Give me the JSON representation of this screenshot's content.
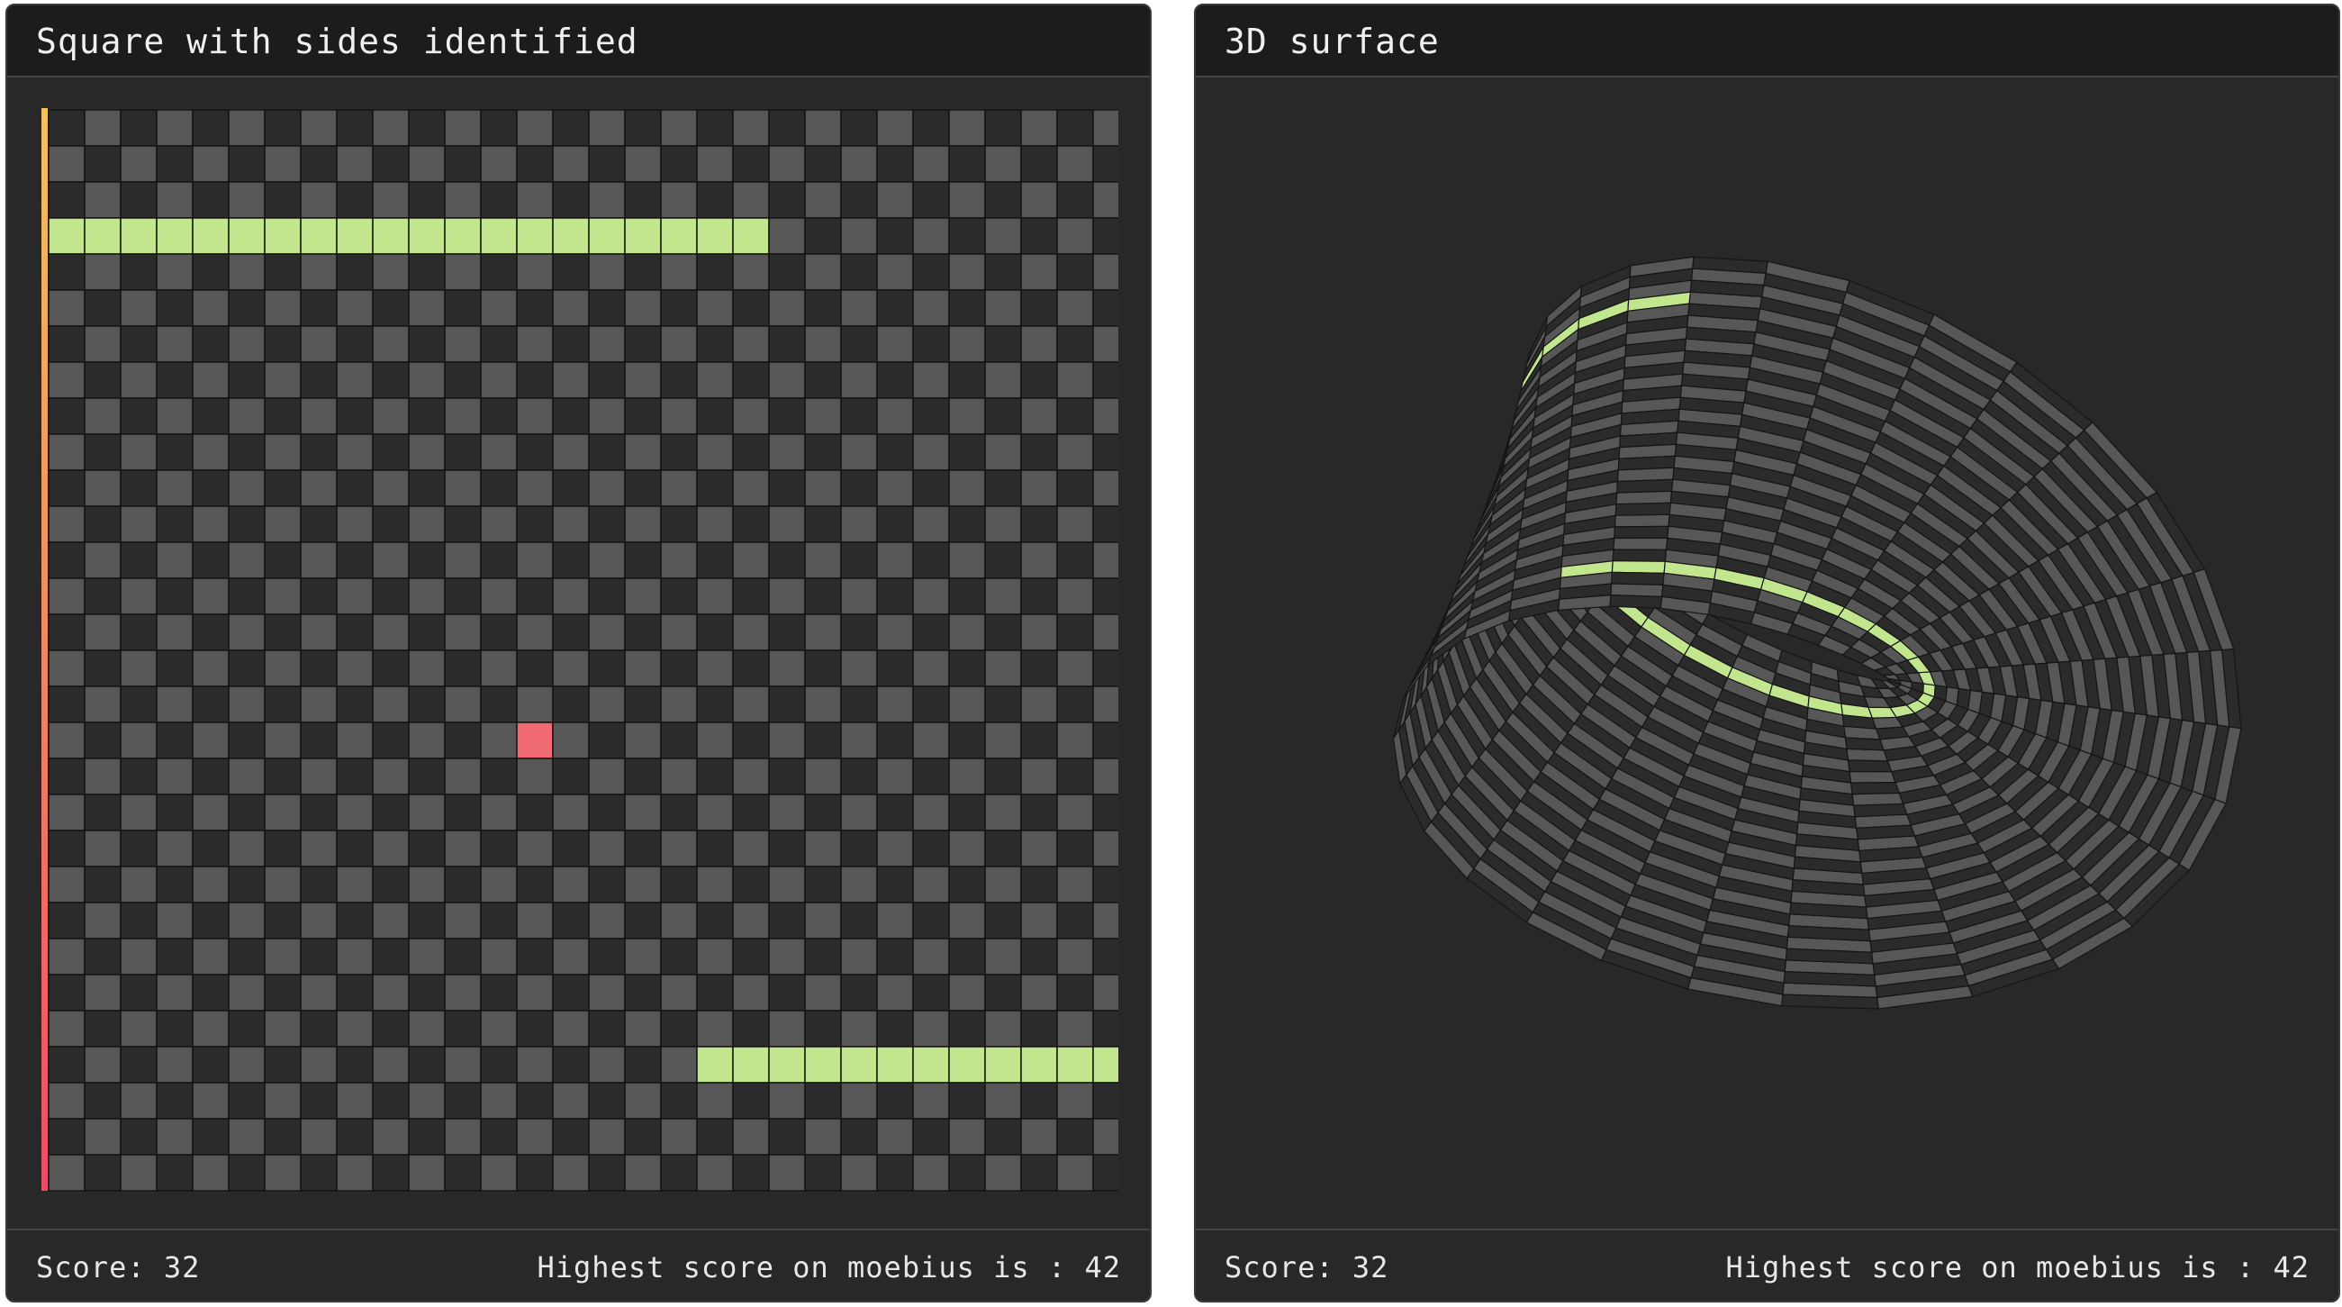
{
  "left_panel": {
    "title": "Square with sides identified",
    "footer": {
      "score_text": "Score: 32",
      "highscore_text": "Highest score on moebius is : 42"
    }
  },
  "right_panel": {
    "title": "3D surface",
    "footer": {
      "score_text": "Score: 32",
      "highscore_text": "Highest score on moebius is : 42"
    }
  },
  "game": {
    "score": 32,
    "highest_score": 42,
    "surface": "moebius",
    "grid_cols": 30,
    "grid_rows": 30,
    "snake_segments": [
      {
        "row": 3,
        "col_start": 0,
        "col_end": 19
      },
      {
        "row": 26,
        "col_start": 18,
        "col_end": 29
      }
    ],
    "food": {
      "row": 17,
      "col": 13
    }
  },
  "colors": {
    "panel_bg": "#282828",
    "header_bg": "#1c1c1c",
    "cell_dark": "#2b2b2b",
    "cell_light": "#575757",
    "grid_line": "#151515",
    "snake": "#c2e68e",
    "food": "#ef6a72",
    "edge_gradient_a": "#f2c35c",
    "edge_gradient_b": "#ec4c66",
    "text": "#e8e8e8"
  }
}
